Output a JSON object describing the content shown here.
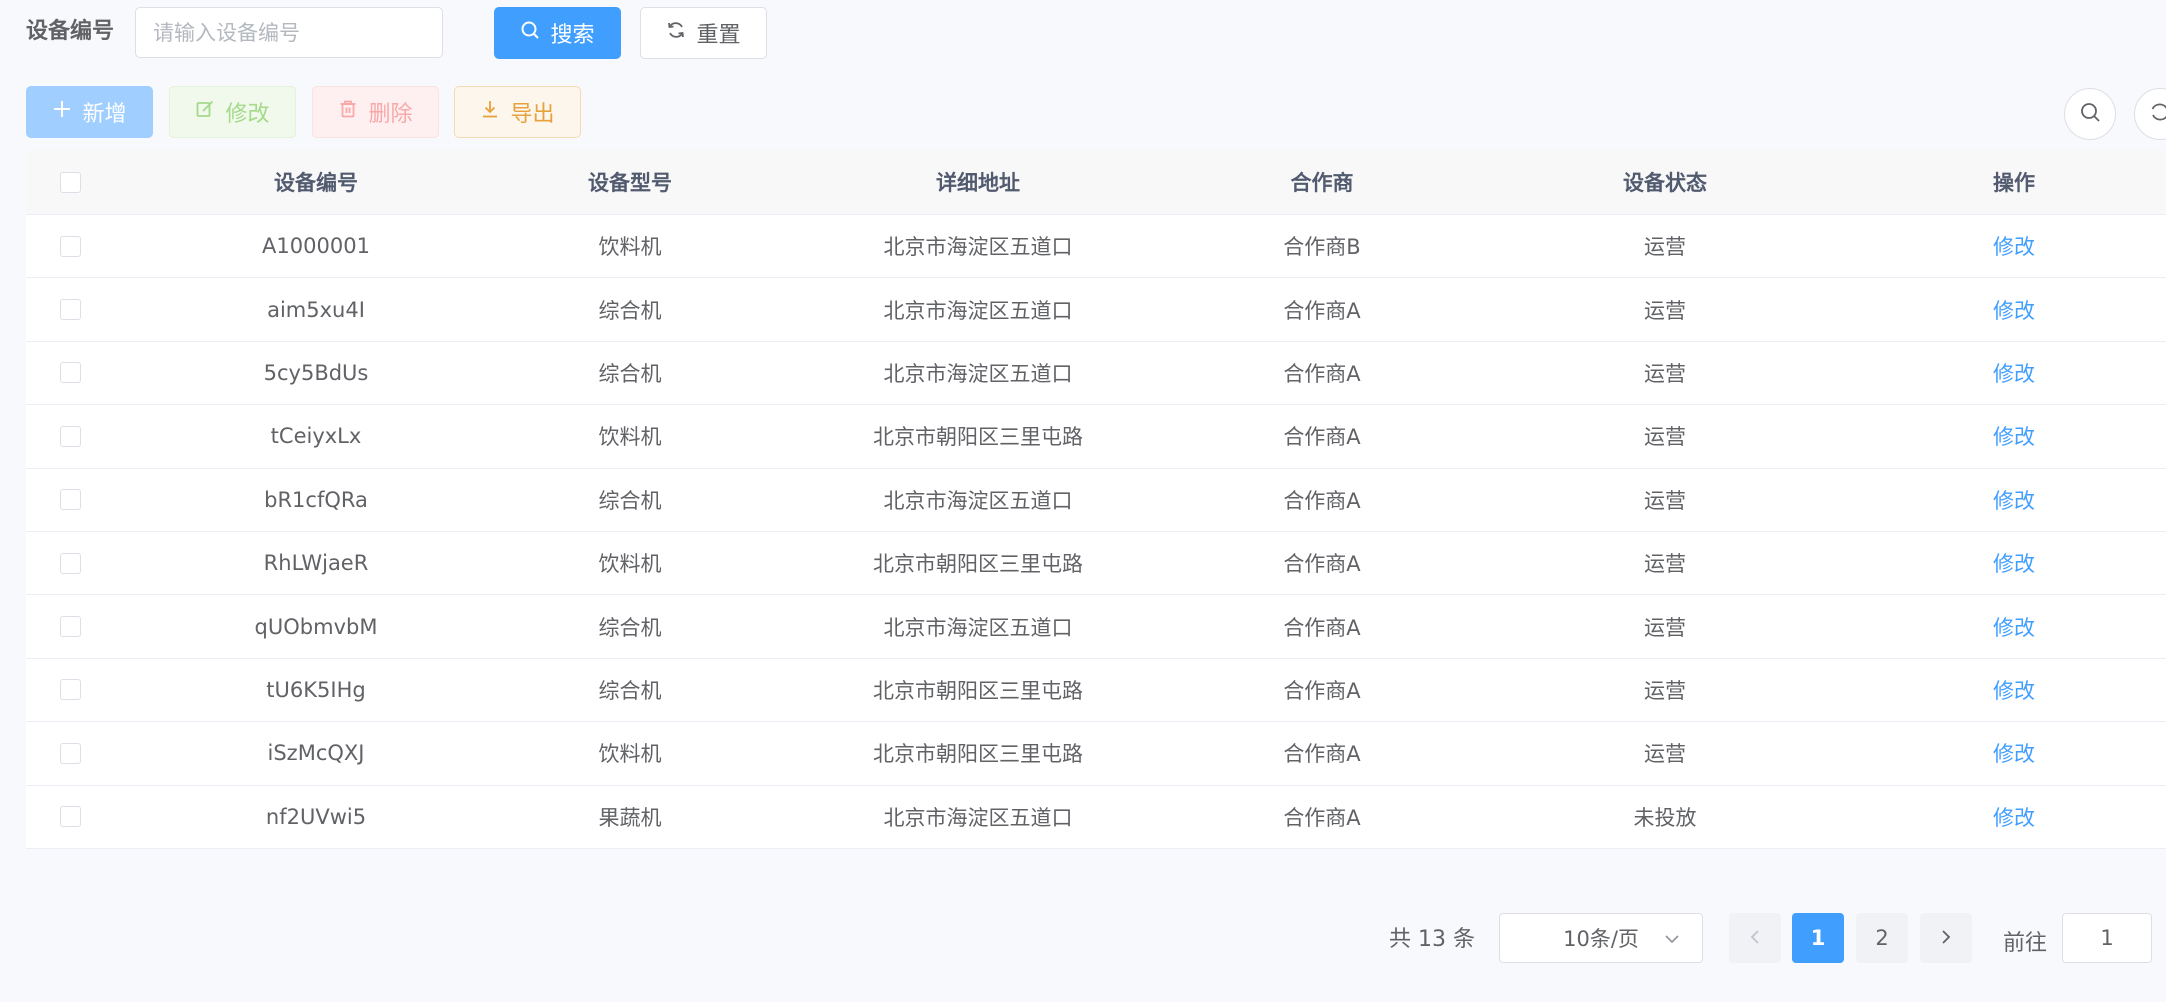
{
  "search_form": {
    "label": "设备编号",
    "input_placeholder": "请输入设备编号",
    "input_value": "",
    "search_button": "搜索",
    "reset_button": "重置"
  },
  "toolbar": {
    "add": "新增",
    "edit": "修改",
    "delete": "删除",
    "export": "导出"
  },
  "table": {
    "headers": {
      "code": "设备编号",
      "model": "设备型号",
      "address": "详细地址",
      "partner": "合作商",
      "status": "设备状态",
      "operation": "操作"
    },
    "rows": [
      {
        "code": "A1000001",
        "model": "饮料机",
        "address": "北京市海淀区五道口",
        "partner": "合作商B",
        "status": "运营",
        "action": "修改"
      },
      {
        "code": "aim5xu4I",
        "model": "综合机",
        "address": "北京市海淀区五道口",
        "partner": "合作商A",
        "status": "运营",
        "action": "修改"
      },
      {
        "code": "5cy5BdUs",
        "model": "综合机",
        "address": "北京市海淀区五道口",
        "partner": "合作商A",
        "status": "运营",
        "action": "修改"
      },
      {
        "code": "tCeiyxLx",
        "model": "饮料机",
        "address": "北京市朝阳区三里屯路",
        "partner": "合作商A",
        "status": "运营",
        "action": "修改"
      },
      {
        "code": "bR1cfQRa",
        "model": "综合机",
        "address": "北京市海淀区五道口",
        "partner": "合作商A",
        "status": "运营",
        "action": "修改"
      },
      {
        "code": "RhLWjaeR",
        "model": "饮料机",
        "address": "北京市朝阳区三里屯路",
        "partner": "合作商A",
        "status": "运营",
        "action": "修改"
      },
      {
        "code": "qUObmvbM",
        "model": "综合机",
        "address": "北京市海淀区五道口",
        "partner": "合作商A",
        "status": "运营",
        "action": "修改"
      },
      {
        "code": "tU6K5IHg",
        "model": "综合机",
        "address": "北京市朝阳区三里屯路",
        "partner": "合作商A",
        "status": "运营",
        "action": "修改"
      },
      {
        "code": "iSzMcQXJ",
        "model": "饮料机",
        "address": "北京市朝阳区三里屯路",
        "partner": "合作商A",
        "status": "运营",
        "action": "修改"
      },
      {
        "code": "nf2UVwi5",
        "model": "果蔬机",
        "address": "北京市海淀区五道口",
        "partner": "合作商A",
        "status": "未投放",
        "action": "修改"
      }
    ]
  },
  "pagination": {
    "total": "共 13 条",
    "page_size": "10条/页",
    "pages": [
      "1",
      "2"
    ],
    "current_page": "1",
    "goto_label": "前往",
    "goto_value": "1"
  },
  "colors": {
    "primary": "#409eff",
    "success_light": "#f0f9eb",
    "danger_light": "#fef0f0",
    "warning": "#e6a23c"
  }
}
